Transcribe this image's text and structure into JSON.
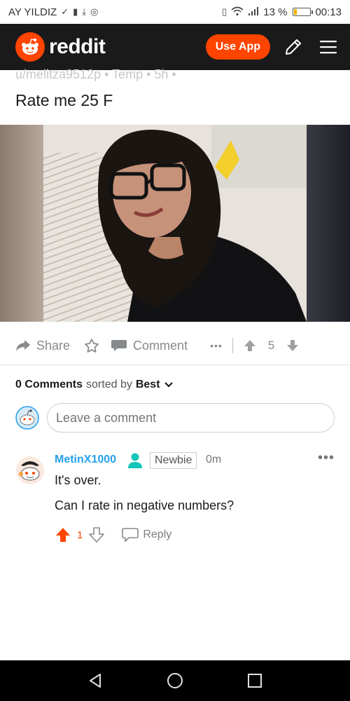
{
  "status_bar": {
    "carrier": "AY YILDIZ",
    "battery": "13 %",
    "battery_level": 0.13,
    "time": "00:13"
  },
  "header": {
    "brand": "reddit",
    "use_app_label": "Use App"
  },
  "post": {
    "meta": "u/melitza9512p • Temp • 5h •",
    "title": "Rate me 25 F"
  },
  "actions": {
    "share": "Share",
    "comment": "Comment",
    "more": "•••",
    "vote_count": "5"
  },
  "comments_header": {
    "count": "0 Comments",
    "sorted_by": "sorted by",
    "sort_value": "Best"
  },
  "comment_input": {
    "placeholder": "Leave a comment"
  },
  "comment": {
    "author": "MetinX1000",
    "flair": "Newbie",
    "time": "0m",
    "line1": "It's over.",
    "line2": "Can I rate in negative numbers?",
    "votes": "1",
    "reply": "Reply"
  },
  "colors": {
    "accent": "#ff4500",
    "author": "#24a0ed",
    "header_bg": "#1a1a1b"
  }
}
